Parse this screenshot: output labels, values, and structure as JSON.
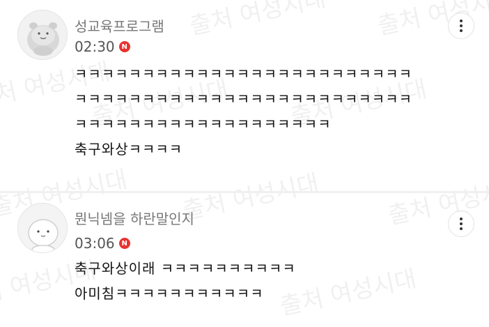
{
  "comments": [
    {
      "username": "성교육프로그램",
      "time": "02:30",
      "badge": "N",
      "lines": [
        "ㅋㅋㅋㅋㅋㅋㅋㅋㅋㅋㅋㅋㅋㅋㅋㅋㅋㅋㅋㅋㅋㅋㅋㅋㅋ",
        "ㅋㅋㅋㅋㅋㅋㅋㅋㅋㅋㅋㅋㅋㅋㅋㅋㅋㅋㅋㅋㅋㅋㅋㅋㅋ",
        "ㅋㅋㅋㅋㅋㅋㅋㅋㅋㅋㅋㅋㅋㅋㅋㅋㅋㅋㅋ",
        "축구와상ㅋㅋㅋㅋ"
      ]
    },
    {
      "username": "뭔닉넴을 하란말인지",
      "time": "03:06",
      "badge": "N",
      "lines": [
        "축구와상이래 ㅋㅋㅋㅋㅋㅋㅋㅋㅋㅋ",
        "아미침ㅋㅋㅋㅋㅋㅋㅋㅋㅋㅋㅋ"
      ]
    }
  ],
  "watermark": "출처 여성시대",
  "icons": {
    "more": "more-vertical-icon",
    "new": "new-badge-icon"
  },
  "colors": {
    "badge": "#e8322f"
  }
}
